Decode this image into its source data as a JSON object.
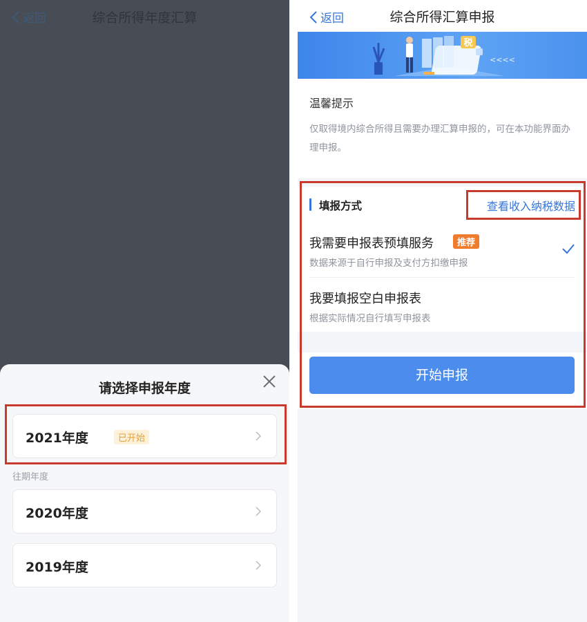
{
  "left": {
    "back_label": "返回",
    "title": "综合所得年度汇算",
    "sheet": {
      "title": "请选择申报年度",
      "current_year": {
        "label": "2021年度",
        "status": "已开始"
      },
      "past_label": "往期年度",
      "past_years": [
        {
          "label": "2020年度"
        },
        {
          "label": "2019年度"
        }
      ]
    }
  },
  "right": {
    "back_label": "返回",
    "title": "综合所得汇算申报",
    "banner": {
      "badge_text": "税",
      "arrows": "<<<<"
    },
    "tip": {
      "title": "温馨提示",
      "text": "仅取得境内综合所得且需要办理汇算申报的，可在本功能界面办理申报。"
    },
    "method": {
      "title": "填报方式",
      "view_data_link": "查看收入纳税数据",
      "options": [
        {
          "title": "我需要申报表预填服务",
          "badge": "推荐",
          "desc": "数据来源于自行申报及支付方扣缴申报",
          "selected": true
        },
        {
          "title": "我要填报空白申报表",
          "desc": "根据实际情况自行填写申报表",
          "selected": false
        }
      ],
      "start_button": "开始申报"
    }
  },
  "colors": {
    "accent": "#3576d8",
    "button": "#4b8cec",
    "highlight_box": "#c83a2c",
    "recommend": "#ef7c2d",
    "status_text": "#e2a13a"
  }
}
